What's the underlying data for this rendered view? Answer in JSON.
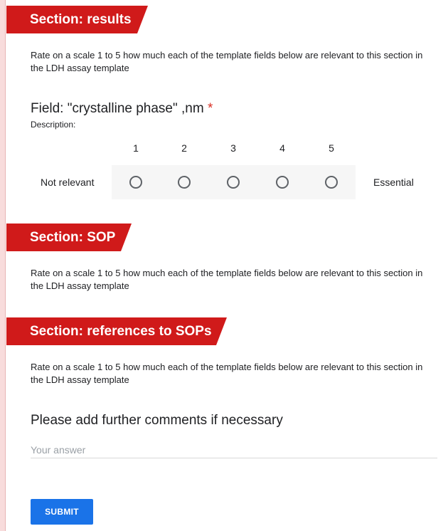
{
  "sections": [
    {
      "title": "Section: results",
      "description": "Rate on a scale 1 to 5 how much each of the template fields below are relevant to this section in the LDH assay template"
    },
    {
      "title": "Section: SOP",
      "description": "Rate on a scale 1 to 5 how much each of the template fields below are relevant to this section in the LDH assay template"
    },
    {
      "title": "Section: references to SOPs",
      "description": "Rate on a scale 1 to 5 how much each of the template fields below are relevant to this section in the LDH assay template"
    }
  ],
  "field": {
    "title": "Field: \"crystalline phase\" ,nm",
    "required_mark": "*",
    "description_label": "Description:",
    "scale": {
      "numbers": [
        "1",
        "2",
        "3",
        "4",
        "5"
      ],
      "low_label": "Not relevant",
      "high_label": "Essential",
      "selected": null
    }
  },
  "comments": {
    "title": "Please add further comments if necessary",
    "placeholder": "Your answer",
    "value": ""
  },
  "submit_label": "SUBMIT",
  "colors": {
    "section_header": "#d01a1a",
    "submit_button": "#1a73e8",
    "required": "#d93025"
  }
}
